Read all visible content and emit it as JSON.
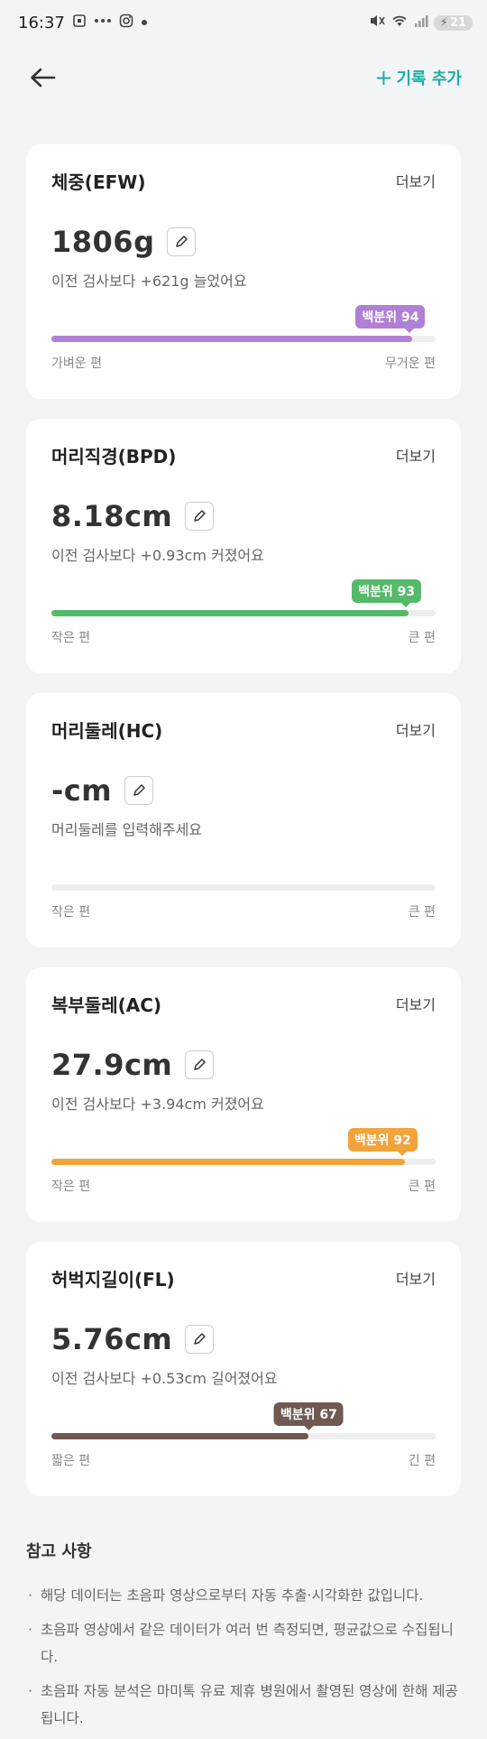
{
  "status_bar": {
    "time": "16:37",
    "battery": "21",
    "notification_icons": [
      "screenshot-icon",
      "link-icon",
      "instagram-icon",
      "dot-icon"
    ]
  },
  "appbar": {
    "add_label": "기록 추가",
    "accent": "#1ab0a4"
  },
  "cards": [
    {
      "title": "체중(EFW)",
      "more": "더보기",
      "value": "1806g",
      "desc": "이전 검사보다 +621g 늘었어요",
      "percentile": 94,
      "badge": "백분위 94",
      "color": "#b07fd6",
      "low": "가벼운 편",
      "high": "무거운 편"
    },
    {
      "title": "머리직경(BPD)",
      "more": "더보기",
      "value": "8.18cm",
      "desc": "이전 검사보다 +0.93cm 커졌어요",
      "percentile": 93,
      "badge": "백분위 93",
      "color": "#55b96a",
      "low": "작은 편",
      "high": "큰 편"
    },
    {
      "title": "머리둘레(HC)",
      "more": "더보기",
      "value": "-cm",
      "desc": "머리둘레를 입력해주세요",
      "percentile": 0,
      "badge": "",
      "color": "#cccccc",
      "low": "작은 편",
      "high": "큰 편"
    },
    {
      "title": "복부둘레(AC)",
      "more": "더보기",
      "value": "27.9cm",
      "desc": "이전 검사보다 +3.94cm 커졌어요",
      "percentile": 92,
      "badge": "백분위 92",
      "color": "#f2a33a",
      "low": "작은 편",
      "high": "큰 편"
    },
    {
      "title": "허벅지길이(FL)",
      "more": "더보기",
      "value": "5.76cm",
      "desc": "이전 검사보다 +0.53cm 길어졌어요",
      "percentile": 67,
      "badge": "백분위 67",
      "color": "#6e5a50",
      "low": "짧은 편",
      "high": "긴 편"
    }
  ],
  "notes": {
    "title": "참고 사항",
    "items": [
      "해당 데이터는 초음파 영상으로부터 자동 추출·시각화한 값입니다.",
      "초음파 영상에서 같은 데이터가 여러 번 측정되면, 평균값으로 수집됩니다.",
      "초음파 자동 분석은 마미톡 유료 제휴 병원에서 촬영된 영상에 한해 제공됩니다."
    ]
  }
}
